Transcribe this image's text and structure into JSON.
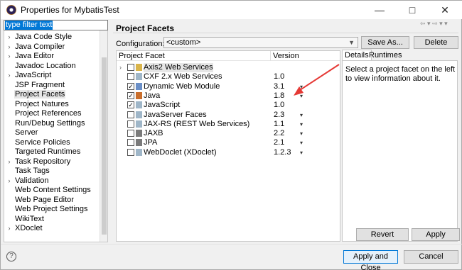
{
  "window": {
    "title": "Properties for MybatisTest"
  },
  "titlebar": {
    "minimize_icon": "minimize-icon",
    "maximize_icon": "maximize-icon",
    "close_icon": "close-icon"
  },
  "left": {
    "filter_text": "type filter text",
    "items": [
      {
        "label": "Java Code Style",
        "expandable": true
      },
      {
        "label": "Java Compiler",
        "expandable": true
      },
      {
        "label": "Java Editor",
        "expandable": true
      },
      {
        "label": "Javadoc Location",
        "expandable": false
      },
      {
        "label": "JavaScript",
        "expandable": true
      },
      {
        "label": "JSP Fragment",
        "expandable": false
      },
      {
        "label": "Project Facets",
        "expandable": false,
        "selected": true
      },
      {
        "label": "Project Natures",
        "expandable": false
      },
      {
        "label": "Project References",
        "expandable": false
      },
      {
        "label": "Run/Debug Settings",
        "expandable": false
      },
      {
        "label": "Server",
        "expandable": false
      },
      {
        "label": "Service Policies",
        "expandable": false
      },
      {
        "label": "Targeted Runtimes",
        "expandable": false
      },
      {
        "label": "Task Repository",
        "expandable": true
      },
      {
        "label": "Task Tags",
        "expandable": false
      },
      {
        "label": "Validation",
        "expandable": true
      },
      {
        "label": "Web Content Settings",
        "expandable": false
      },
      {
        "label": "Web Page Editor",
        "expandable": false
      },
      {
        "label": "Web Project Settings",
        "expandable": false
      },
      {
        "label": "WikiText",
        "expandable": false
      },
      {
        "label": "XDoclet",
        "expandable": true
      }
    ]
  },
  "main": {
    "title": "Project Facets",
    "configuration_label": "Configuration:",
    "configuration_value": "<custom>",
    "save_as": "Save As...",
    "delete": "Delete",
    "columns": {
      "facet": "Project Facet",
      "version": "Version"
    },
    "facets": [
      {
        "name": "Axis2 Web Services",
        "version": "",
        "checked": false,
        "expandable": true,
        "icon": "folder-icon",
        "boxed": true,
        "dropdown": false
      },
      {
        "name": "CXF 2.x Web Services",
        "version": "1.0",
        "checked": false,
        "icon": "page-icon",
        "dropdown": false
      },
      {
        "name": "Dynamic Web Module",
        "version": "3.1",
        "checked": true,
        "icon": "web-module-icon",
        "dropdown": true
      },
      {
        "name": "Java",
        "version": "1.8",
        "checked": true,
        "icon": "java-icon",
        "dropdown": true
      },
      {
        "name": "JavaScript",
        "version": "1.0",
        "checked": true,
        "icon": "page-icon",
        "dropdown": false
      },
      {
        "name": "JavaServer Faces",
        "version": "2.3",
        "checked": false,
        "icon": "page-icon",
        "dropdown": true
      },
      {
        "name": "JAX-RS (REST Web Services)",
        "version": "1.1",
        "checked": false,
        "icon": "page-icon",
        "dropdown": true
      },
      {
        "name": "JAXB",
        "version": "2.2",
        "checked": false,
        "icon": "jaxb-icon",
        "dropdown": true
      },
      {
        "name": "JPA",
        "version": "2.1",
        "checked": false,
        "icon": "jpa-icon",
        "dropdown": true
      },
      {
        "name": "WebDoclet (XDoclet)",
        "version": "1.2.3",
        "checked": false,
        "icon": "page-icon",
        "dropdown": true
      }
    ],
    "details_tab": "Details",
    "runtimes_tab": "Runtimes",
    "details_text": "Select a project facet on the left to view information about it.",
    "revert": "Revert",
    "apply": "Apply"
  },
  "footer": {
    "apply_close": "Apply and Close",
    "cancel": "Cancel"
  },
  "colors": {
    "accent": "#0078d7",
    "arrow": "#e53935"
  }
}
